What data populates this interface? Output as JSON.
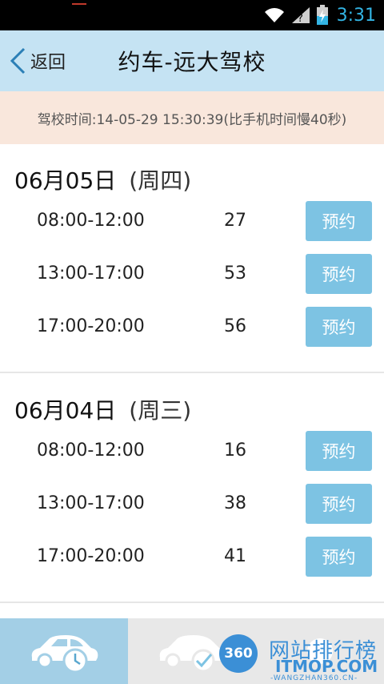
{
  "status_bar": {
    "time": "3:31",
    "icons": [
      "wifi-icon",
      "signal-icon",
      "battery-charging-icon"
    ],
    "clock_color": "#33b5e5"
  },
  "header": {
    "back_label": "返回",
    "title": "约车-远大驾校",
    "background": "#c5e3f3"
  },
  "banner": {
    "text": "驾校时间:14-05-29 15:30:39(比手机时间慢40秒)",
    "background": "#f9e7dc"
  },
  "days": [
    {
      "date": "06月05日",
      "weekday": "(周四)",
      "slots": [
        {
          "time": "08:00-12:00",
          "count": "27",
          "button": "预约"
        },
        {
          "time": "13:00-17:00",
          "count": "53",
          "button": "预约"
        },
        {
          "time": "17:00-20:00",
          "count": "56",
          "button": "预约"
        }
      ]
    },
    {
      "date": "06月04日",
      "weekday": "(周三)",
      "slots": [
        {
          "time": "08:00-12:00",
          "count": "16",
          "button": "预约"
        },
        {
          "time": "13:00-17:00",
          "count": "38",
          "button": "预约"
        },
        {
          "time": "17:00-20:00",
          "count": "41",
          "button": "预约"
        }
      ]
    }
  ],
  "bottom_tabs": [
    {
      "icon": "car-clock-icon",
      "active": true
    },
    {
      "icon": "car-check-icon",
      "active": false
    },
    {
      "icon": "more-icon",
      "active": false
    }
  ],
  "watermark": {
    "badge": "360",
    "title": "网站排行榜",
    "domain": "ITMOP.COM",
    "sub": "-WANGZHAN360.CN-"
  },
  "colors": {
    "accent_button": "#7dc3e3",
    "active_tab": "#a3cfe6"
  }
}
